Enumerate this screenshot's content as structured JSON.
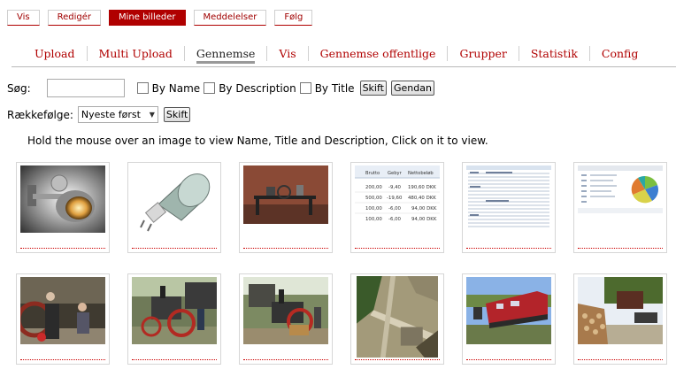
{
  "top_tabs": [
    {
      "label": "Vis"
    },
    {
      "label": "Redigér"
    },
    {
      "label": "Mine billeder",
      "active": true
    },
    {
      "label": "Meddelelser"
    },
    {
      "label": "Følg"
    }
  ],
  "sub_nav": [
    {
      "label": "Upload"
    },
    {
      "label": "Multi Upload"
    },
    {
      "label": "Gennemse",
      "current": true
    },
    {
      "label": "Vis"
    },
    {
      "label": "Gennemse offentlige"
    },
    {
      "label": "Grupper"
    },
    {
      "label": "Statistik"
    },
    {
      "label": "Config"
    }
  ],
  "search": {
    "label": "Søg:",
    "value": "",
    "options": [
      "By Name",
      "By Description",
      "By Title"
    ],
    "submit_label": "Skift",
    "reset_label": "Gendan"
  },
  "order": {
    "label": "Rækkefølge:",
    "selected": "Nyeste først",
    "submit_label": "Skift"
  },
  "hint": "Hold the mouse over an image to view Name, Title and Description, Click on it to view.",
  "table_thumb": {
    "headers": [
      "Brutto",
      "Gebyr",
      "Nettobeløb"
    ],
    "rows": [
      [
        "200,00",
        "-9,40",
        "190,60 DKK"
      ],
      [
        "500,00",
        "-19,60",
        "480,40 DKK"
      ],
      [
        "100,00",
        "-6,00",
        "94,00 DKK"
      ],
      [
        "100,00",
        "-6,00",
        "94,00 DKK"
      ]
    ]
  },
  "thumbnails": [
    {
      "subject": "spotlight"
    },
    {
      "subject": "halogen-bulb"
    },
    {
      "subject": "machine"
    },
    {
      "subject": "payment-table"
    },
    {
      "subject": "data-list"
    },
    {
      "subject": "dashboard-pie"
    },
    {
      "subject": "steam-engine"
    },
    {
      "subject": "traction-engine"
    },
    {
      "subject": "steam-engine-2"
    },
    {
      "subject": "aerial-view"
    },
    {
      "subject": "red-locomotive"
    },
    {
      "subject": "woodpile"
    }
  ]
}
